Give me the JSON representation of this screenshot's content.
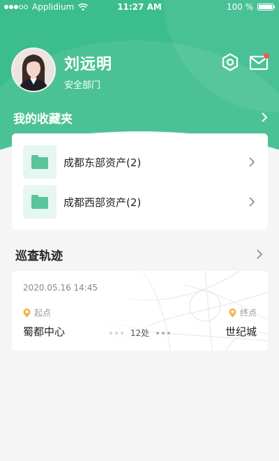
{
  "status_bar": {
    "carrier": "Applidium",
    "time": "11:27 AM",
    "battery": "100 %"
  },
  "profile": {
    "name": "刘远明",
    "department": "安全部门"
  },
  "icons": {
    "settings": "gear-icon",
    "mail": "mail-icon",
    "mail_badge_color": "#f05a4a"
  },
  "favorites": {
    "title": "我的收藏夹",
    "items": [
      {
        "label": "成都东部资产(2)",
        "icon": "folder-icon"
      },
      {
        "label": "成都西部资产(2)",
        "icon": "folder-icon"
      }
    ]
  },
  "patrol": {
    "title": "巡查轨迹",
    "time": "2020.05.16 14:45",
    "start_tag": "起点",
    "end_tag": "终点",
    "start_name": "蜀都中心",
    "end_name": "世纪城",
    "count": "12处"
  },
  "colors": {
    "brand": "#3cbd8e",
    "pin": "#f3b44a",
    "folder": "#5bc49a"
  }
}
